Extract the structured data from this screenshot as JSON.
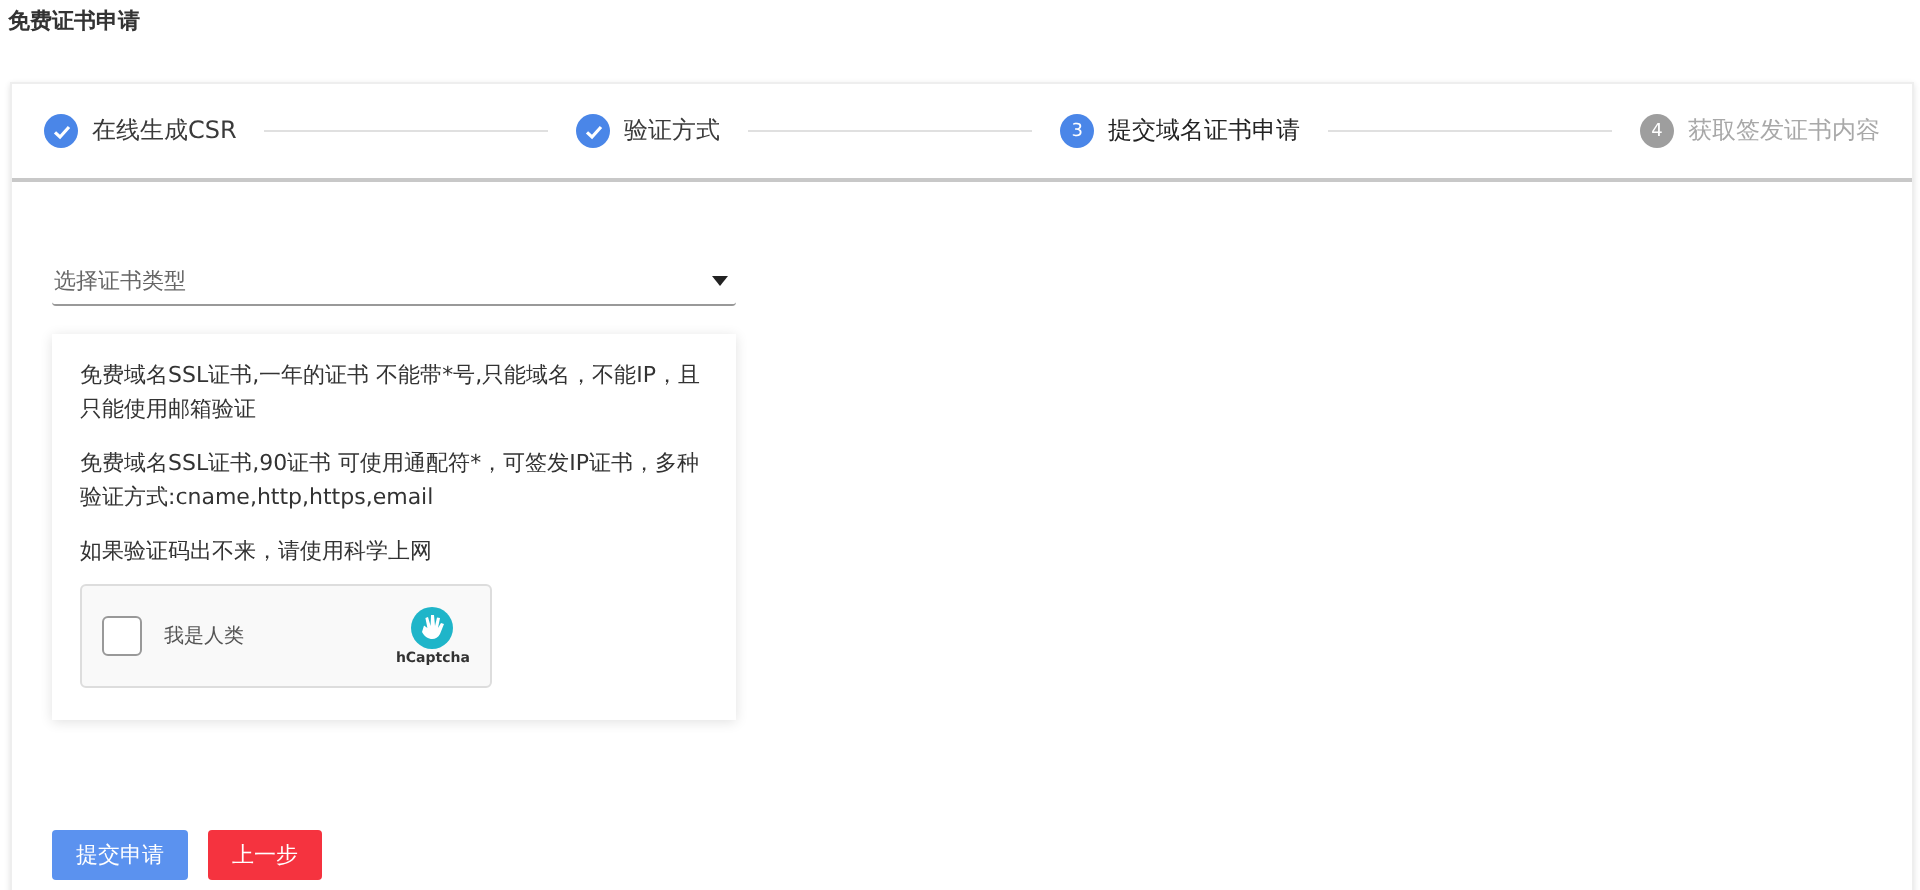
{
  "page_title": "免费证书申请",
  "steps": [
    {
      "label": "在线生成CSR",
      "completed": true,
      "selected": false
    },
    {
      "label": "验证方式",
      "completed": true,
      "selected": false
    },
    {
      "label": "提交域名证书申请",
      "completed": false,
      "selected": true,
      "number": "3"
    },
    {
      "label": "获取签发证书内容",
      "completed": false,
      "selected": false,
      "number": "4"
    }
  ],
  "select": {
    "placeholder": "选择证书类型"
  },
  "notes": [
    "免费域名SSL证书,一年的证书 不能带*号,只能域名，不能IP，且只能使用邮箱验证",
    "免费域名SSL证书,90证书 可使用通配符*，可签发IP证书，多种验证方式:cname,http,https,email",
    "如果验证码出不来，请使用科学上网"
  ],
  "captcha": {
    "label": "我是人类",
    "checked": false,
    "brand": "hCaptcha"
  },
  "buttons": [
    {
      "label": "提交申请",
      "kind": "primary"
    },
    {
      "label": "上一步",
      "kind": "danger"
    }
  ]
}
